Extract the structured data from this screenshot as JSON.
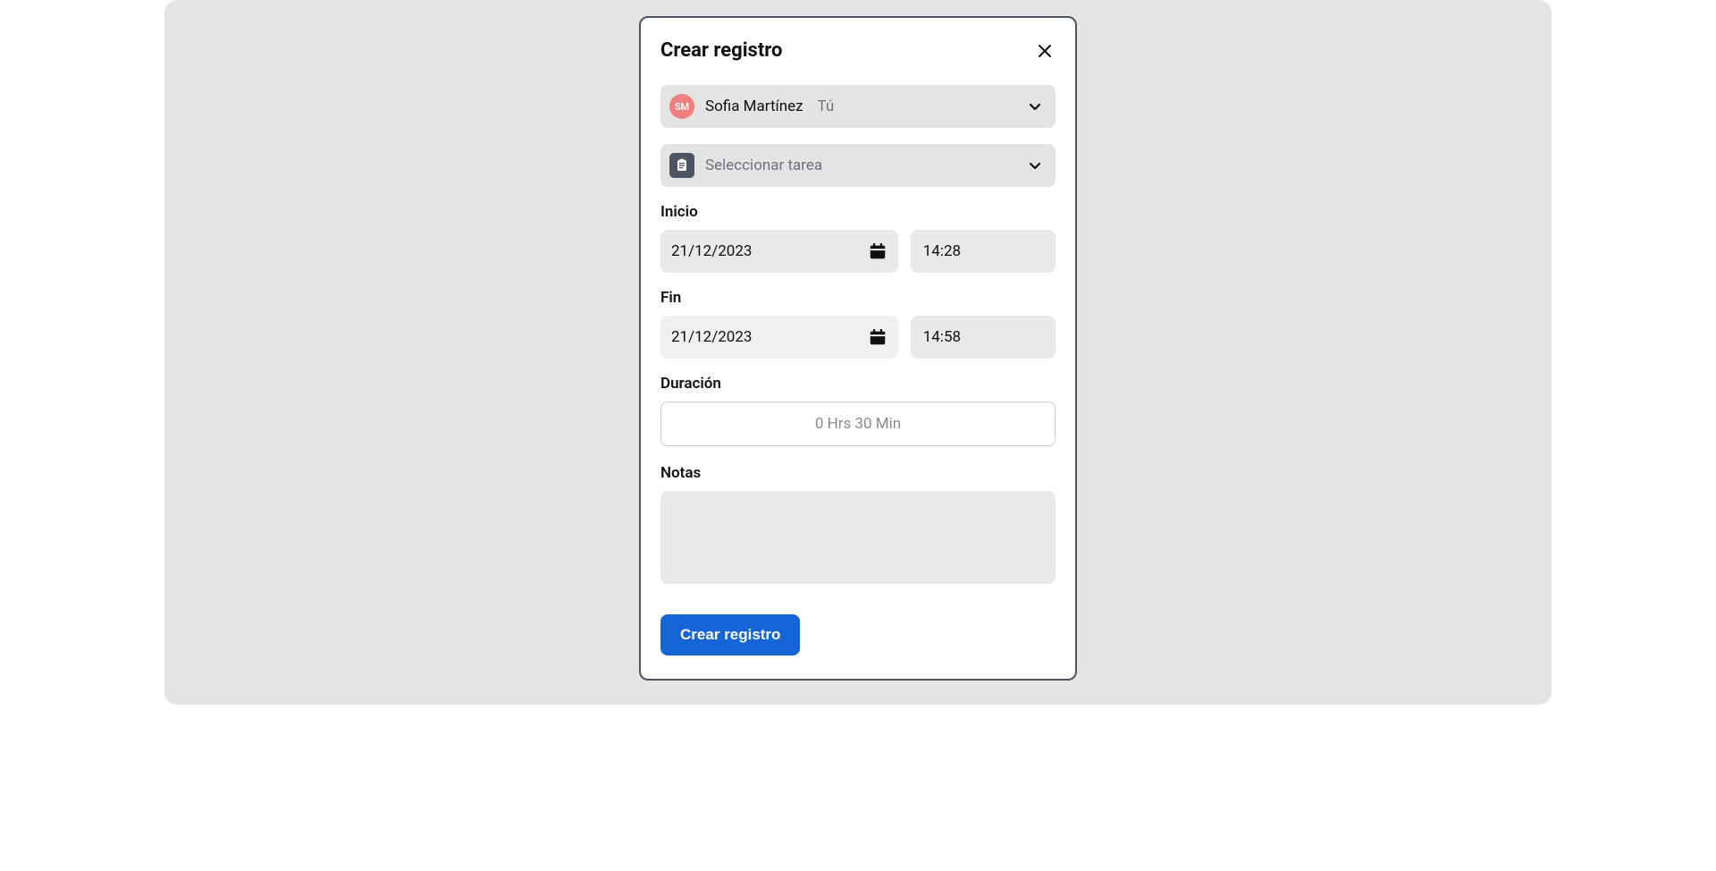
{
  "modal": {
    "title": "Crear registro",
    "user": {
      "initials": "SM",
      "name": "Sofia Martínez",
      "you_label": "Tú"
    },
    "task": {
      "placeholder": "Seleccionar tarea"
    },
    "start": {
      "label": "Inicio",
      "date": "21/12/2023",
      "time": "14:28"
    },
    "end": {
      "label": "Fin",
      "date": "21/12/2023",
      "time": "14:58"
    },
    "duration": {
      "label": "Duración",
      "value": "0 Hrs 30 Min"
    },
    "notes": {
      "label": "Notas",
      "value": ""
    },
    "submit_label": "Crear registro"
  }
}
